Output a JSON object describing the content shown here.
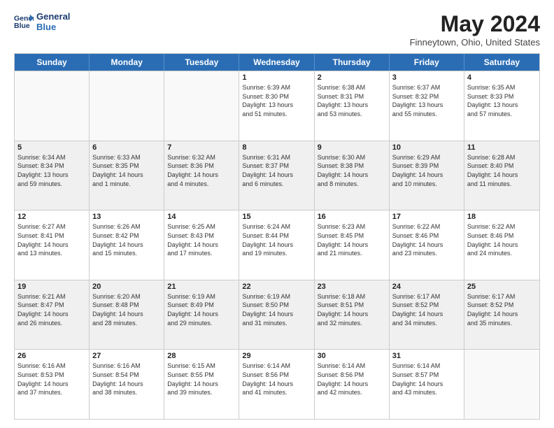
{
  "header": {
    "logo_line1": "General",
    "logo_line2": "Blue",
    "month_year": "May 2024",
    "location": "Finneytown, Ohio, United States"
  },
  "weekdays": [
    "Sunday",
    "Monday",
    "Tuesday",
    "Wednesday",
    "Thursday",
    "Friday",
    "Saturday"
  ],
  "rows": [
    [
      {
        "day": "",
        "lines": []
      },
      {
        "day": "",
        "lines": []
      },
      {
        "day": "",
        "lines": []
      },
      {
        "day": "1",
        "lines": [
          "Sunrise: 6:39 AM",
          "Sunset: 8:30 PM",
          "Daylight: 13 hours",
          "and 51 minutes."
        ]
      },
      {
        "day": "2",
        "lines": [
          "Sunrise: 6:38 AM",
          "Sunset: 8:31 PM",
          "Daylight: 13 hours",
          "and 53 minutes."
        ]
      },
      {
        "day": "3",
        "lines": [
          "Sunrise: 6:37 AM",
          "Sunset: 8:32 PM",
          "Daylight: 13 hours",
          "and 55 minutes."
        ]
      },
      {
        "day": "4",
        "lines": [
          "Sunrise: 6:35 AM",
          "Sunset: 8:33 PM",
          "Daylight: 13 hours",
          "and 57 minutes."
        ]
      }
    ],
    [
      {
        "day": "5",
        "lines": [
          "Sunrise: 6:34 AM",
          "Sunset: 8:34 PM",
          "Daylight: 13 hours",
          "and 59 minutes."
        ]
      },
      {
        "day": "6",
        "lines": [
          "Sunrise: 6:33 AM",
          "Sunset: 8:35 PM",
          "Daylight: 14 hours",
          "and 1 minute."
        ]
      },
      {
        "day": "7",
        "lines": [
          "Sunrise: 6:32 AM",
          "Sunset: 8:36 PM",
          "Daylight: 14 hours",
          "and 4 minutes."
        ]
      },
      {
        "day": "8",
        "lines": [
          "Sunrise: 6:31 AM",
          "Sunset: 8:37 PM",
          "Daylight: 14 hours",
          "and 6 minutes."
        ]
      },
      {
        "day": "9",
        "lines": [
          "Sunrise: 6:30 AM",
          "Sunset: 8:38 PM",
          "Daylight: 14 hours",
          "and 8 minutes."
        ]
      },
      {
        "day": "10",
        "lines": [
          "Sunrise: 6:29 AM",
          "Sunset: 8:39 PM",
          "Daylight: 14 hours",
          "and 10 minutes."
        ]
      },
      {
        "day": "11",
        "lines": [
          "Sunrise: 6:28 AM",
          "Sunset: 8:40 PM",
          "Daylight: 14 hours",
          "and 11 minutes."
        ]
      }
    ],
    [
      {
        "day": "12",
        "lines": [
          "Sunrise: 6:27 AM",
          "Sunset: 8:41 PM",
          "Daylight: 14 hours",
          "and 13 minutes."
        ]
      },
      {
        "day": "13",
        "lines": [
          "Sunrise: 6:26 AM",
          "Sunset: 8:42 PM",
          "Daylight: 14 hours",
          "and 15 minutes."
        ]
      },
      {
        "day": "14",
        "lines": [
          "Sunrise: 6:25 AM",
          "Sunset: 8:43 PM",
          "Daylight: 14 hours",
          "and 17 minutes."
        ]
      },
      {
        "day": "15",
        "lines": [
          "Sunrise: 6:24 AM",
          "Sunset: 8:44 PM",
          "Daylight: 14 hours",
          "and 19 minutes."
        ]
      },
      {
        "day": "16",
        "lines": [
          "Sunrise: 6:23 AM",
          "Sunset: 8:45 PM",
          "Daylight: 14 hours",
          "and 21 minutes."
        ]
      },
      {
        "day": "17",
        "lines": [
          "Sunrise: 6:22 AM",
          "Sunset: 8:46 PM",
          "Daylight: 14 hours",
          "and 23 minutes."
        ]
      },
      {
        "day": "18",
        "lines": [
          "Sunrise: 6:22 AM",
          "Sunset: 8:46 PM",
          "Daylight: 14 hours",
          "and 24 minutes."
        ]
      }
    ],
    [
      {
        "day": "19",
        "lines": [
          "Sunrise: 6:21 AM",
          "Sunset: 8:47 PM",
          "Daylight: 14 hours",
          "and 26 minutes."
        ]
      },
      {
        "day": "20",
        "lines": [
          "Sunrise: 6:20 AM",
          "Sunset: 8:48 PM",
          "Daylight: 14 hours",
          "and 28 minutes."
        ]
      },
      {
        "day": "21",
        "lines": [
          "Sunrise: 6:19 AM",
          "Sunset: 8:49 PM",
          "Daylight: 14 hours",
          "and 29 minutes."
        ]
      },
      {
        "day": "22",
        "lines": [
          "Sunrise: 6:19 AM",
          "Sunset: 8:50 PM",
          "Daylight: 14 hours",
          "and 31 minutes."
        ]
      },
      {
        "day": "23",
        "lines": [
          "Sunrise: 6:18 AM",
          "Sunset: 8:51 PM",
          "Daylight: 14 hours",
          "and 32 minutes."
        ]
      },
      {
        "day": "24",
        "lines": [
          "Sunrise: 6:17 AM",
          "Sunset: 8:52 PM",
          "Daylight: 14 hours",
          "and 34 minutes."
        ]
      },
      {
        "day": "25",
        "lines": [
          "Sunrise: 6:17 AM",
          "Sunset: 8:52 PM",
          "Daylight: 14 hours",
          "and 35 minutes."
        ]
      }
    ],
    [
      {
        "day": "26",
        "lines": [
          "Sunrise: 6:16 AM",
          "Sunset: 8:53 PM",
          "Daylight: 14 hours",
          "and 37 minutes."
        ]
      },
      {
        "day": "27",
        "lines": [
          "Sunrise: 6:16 AM",
          "Sunset: 8:54 PM",
          "Daylight: 14 hours",
          "and 38 minutes."
        ]
      },
      {
        "day": "28",
        "lines": [
          "Sunrise: 6:15 AM",
          "Sunset: 8:55 PM",
          "Daylight: 14 hours",
          "and 39 minutes."
        ]
      },
      {
        "day": "29",
        "lines": [
          "Sunrise: 6:14 AM",
          "Sunset: 8:56 PM",
          "Daylight: 14 hours",
          "and 41 minutes."
        ]
      },
      {
        "day": "30",
        "lines": [
          "Sunrise: 6:14 AM",
          "Sunset: 8:56 PM",
          "Daylight: 14 hours",
          "and 42 minutes."
        ]
      },
      {
        "day": "31",
        "lines": [
          "Sunrise: 6:14 AM",
          "Sunset: 8:57 PM",
          "Daylight: 14 hours",
          "and 43 minutes."
        ]
      },
      {
        "day": "",
        "lines": []
      }
    ]
  ]
}
